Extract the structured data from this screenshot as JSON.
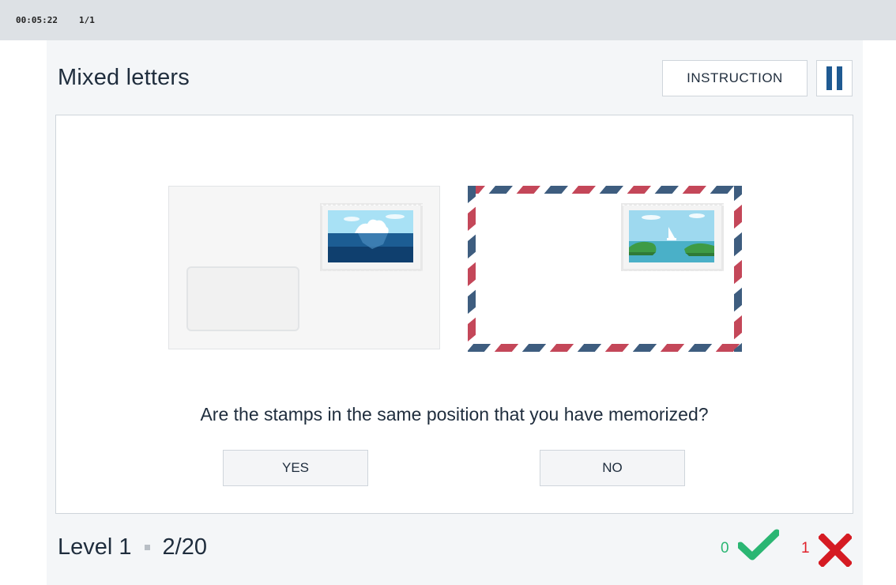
{
  "status": {
    "timer": "00:05:22",
    "counter": "1/1"
  },
  "header": {
    "title": "Mixed letters",
    "instruction_label": "INSTRUCTION"
  },
  "task": {
    "question": "Are the stamps in the same position that you have memorized?"
  },
  "buttons": {
    "yes": "YES",
    "no": "NO"
  },
  "footer": {
    "level": "Level 1",
    "progress": "2/20",
    "correct_count": "0",
    "wrong_count": "1"
  },
  "icons": {
    "pause": "pause-icon",
    "check": "check-icon",
    "cross": "cross-icon",
    "iceberg_stamp": "iceberg-stamp",
    "island_stamp": "island-stamp"
  },
  "colors": {
    "accent_blue": "#1f5a92",
    "correct_green": "#2bb673",
    "wrong_red": "#e0212b",
    "air_red": "#c44759",
    "air_blue": "#3e5d7f"
  }
}
